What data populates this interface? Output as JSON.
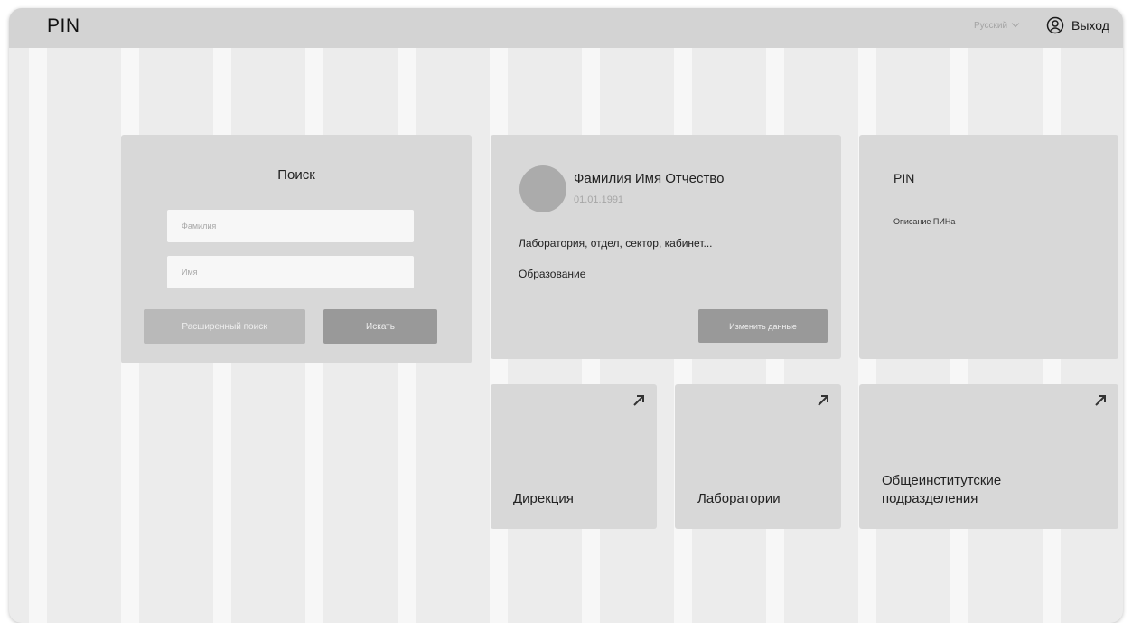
{
  "header": {
    "logo": "PIN",
    "language": "Русский",
    "logout_label": "Выход"
  },
  "search": {
    "title": "Поиск",
    "surname_placeholder": "Фамилия",
    "name_placeholder": "Имя",
    "advanced_button": "Расширенный поиск",
    "search_button": "Искать"
  },
  "profile": {
    "full_name": "Фамилия Имя Отчество",
    "birth_date": "01.01.1991",
    "department": "Лаборатория, отдел, сектор, кабинет...",
    "education": "Образование",
    "edit_button": "Изменить данные"
  },
  "pin_info": {
    "title": "PIN",
    "description": "Описание ПИНа"
  },
  "tiles": [
    {
      "label": "Дирекция",
      "icon": "arrow-up-right-icon"
    },
    {
      "label": "Лаборатории",
      "icon": "arrow-up-right-icon"
    },
    {
      "label": "Общеинститутские подразделения",
      "icon": "arrow-up-right-icon"
    }
  ],
  "colors": {
    "background": "#ececec",
    "header": "#d3d3d3",
    "card": "#d8d8d8",
    "primary_button": "#999999",
    "secondary_button": "#b9b9b9"
  }
}
